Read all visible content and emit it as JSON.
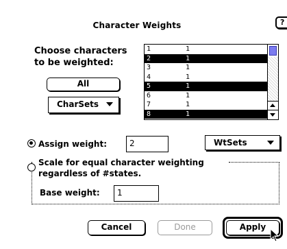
{
  "dialog": {
    "title": "Character Weights",
    "help_label": "?",
    "prompt": "Choose characters\nto be weighted:",
    "all_button": "All",
    "charsets_label": "CharSets",
    "list": [
      {
        "num": "1",
        "weight": "1",
        "selected": false
      },
      {
        "num": "2",
        "weight": "1",
        "selected": true
      },
      {
        "num": "3",
        "weight": "1",
        "selected": false
      },
      {
        "num": "4",
        "weight": "1",
        "selected": false
      },
      {
        "num": "5",
        "weight": "1",
        "selected": true
      },
      {
        "num": "6",
        "weight": "1",
        "selected": false
      },
      {
        "num": "7",
        "weight": "1",
        "selected": false
      },
      {
        "num": "8",
        "weight": "1",
        "selected": true
      }
    ],
    "assign_label": "Assign weight:",
    "assign_value": "2",
    "assign_selected": true,
    "wtsets_label": "WtSets",
    "scale_label": "Scale for equal character weighting\nregardless of #states.",
    "base_label": "Base weight:",
    "base_value": "1",
    "cancel_label": "Cancel",
    "done_label": "Done",
    "apply_label": "Apply"
  },
  "colors": {
    "scroll_thumb": "#7c7cf0",
    "disabled_text": "#9a9a9a"
  }
}
